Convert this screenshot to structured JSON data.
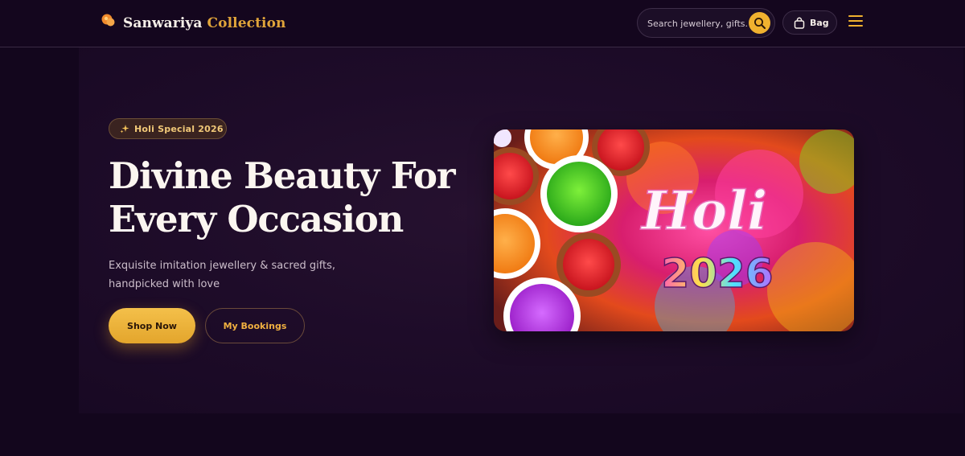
{
  "header": {
    "brand_name": "Sanwariya",
    "brand_suffix": "Collection",
    "logo_icon": "logo-icon",
    "search": {
      "placeholder": "Search jewellery, gifts...",
      "icon": "search-icon"
    },
    "bag": {
      "label": "Bag",
      "icon": "bag-icon"
    },
    "menu_icon": "hamburger-menu-icon"
  },
  "hero": {
    "badge_icon": "sparkles-icon",
    "badge": "Holi Special 2026",
    "headline": "Divine Beauty For Every Occasion",
    "subtitle": "Exquisite imitation jewellery & sacred gifts, handpicked with love",
    "primary_button": "Shop Now",
    "secondary_button": "My Bookings",
    "banner": {
      "title": "Holi",
      "year": "2026"
    }
  },
  "colors": {
    "accent": "#f0b12f",
    "background": "#13061d",
    "headline": "#fbf6f0"
  }
}
